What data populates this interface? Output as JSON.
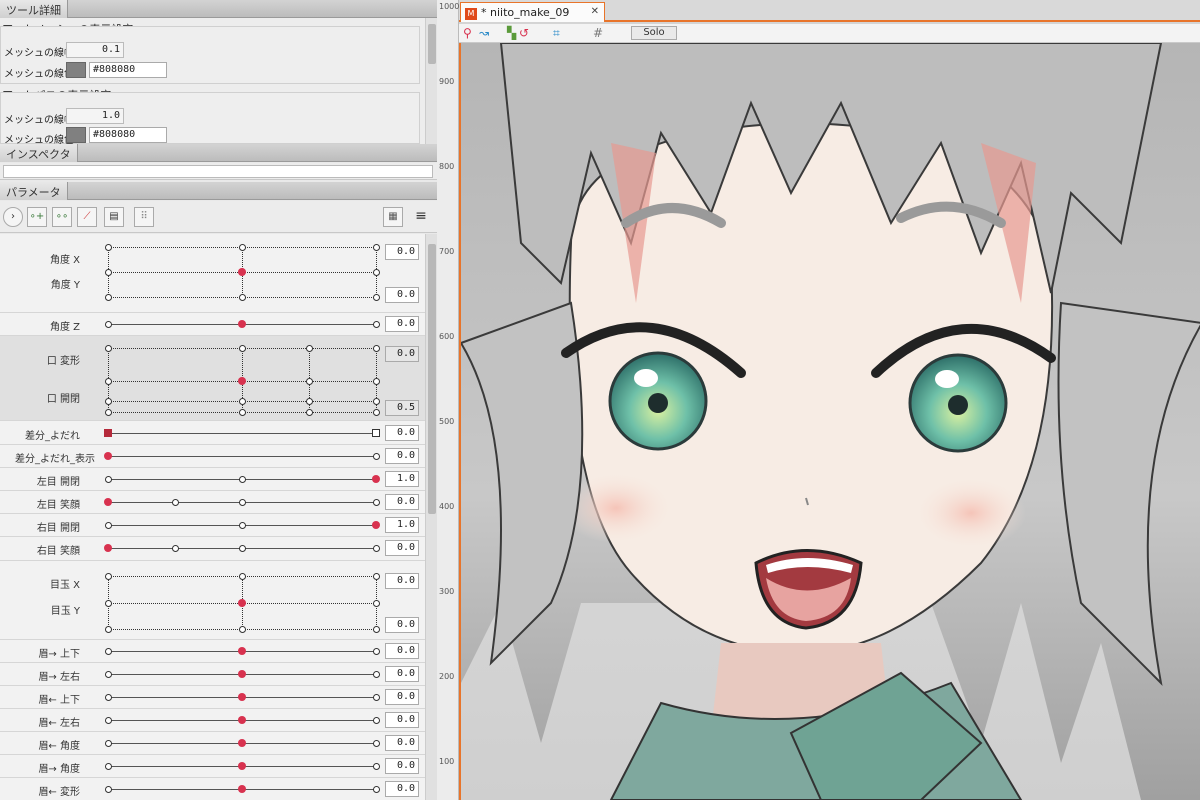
{
  "tool_panel": {
    "title": "ツール詳細",
    "section1": "アートメッシュの表示設定",
    "section2": "アートパスの表示設定",
    "mesh_width_label": "メッシュの線幅",
    "mesh_color_label": "メッシュの線色",
    "mesh_width_value": "0.1",
    "mesh_color_value": "#808080",
    "path_width_value": "1.0",
    "path_color_value": "#808080"
  },
  "inspector": {
    "title": "インスペクタ"
  },
  "params_panel": {
    "title": "パラメータ"
  },
  "params": [
    {
      "label": "角度 X",
      "value": "0.0"
    },
    {
      "label": "角度 Y",
      "value": "0.0"
    },
    {
      "label": "角度 Z",
      "value": "0.0"
    },
    {
      "label": "口 変形",
      "value": "0.0"
    },
    {
      "label": "口 開閉",
      "value": "0.5"
    },
    {
      "label": "差分_よだれ",
      "value": "0.0"
    },
    {
      "label": "差分_よだれ_表示",
      "value": "0.0"
    },
    {
      "label": "左目 開閉",
      "value": "1.0"
    },
    {
      "label": "左目 笑顔",
      "value": "0.0"
    },
    {
      "label": "右目 開閉",
      "value": "1.0"
    },
    {
      "label": "右目 笑顔",
      "value": "0.0"
    },
    {
      "label": "目玉 X",
      "value": "0.0"
    },
    {
      "label": "目玉 Y",
      "value": "0.0"
    },
    {
      "label": "眉→ 上下",
      "value": "0.0"
    },
    {
      "label": "眉→ 左右",
      "value": "0.0"
    },
    {
      "label": "眉← 上下",
      "value": "0.0"
    },
    {
      "label": "眉← 左右",
      "value": "0.0"
    },
    {
      "label": "眉← 角度",
      "value": "0.0"
    },
    {
      "label": "眉→ 角度",
      "value": "0.0"
    },
    {
      "label": "眉← 変形",
      "value": "0.0"
    }
  ],
  "ruler": [
    "1000",
    "900",
    "800",
    "700",
    "600",
    "500",
    "400",
    "300",
    "200",
    "100"
  ],
  "document": {
    "tab_title": "* niito_make_09",
    "solo_label": "Solo"
  },
  "colors": {
    "accent": "#e8742a",
    "key_active": "#d8324f",
    "mesh_color": "#808080"
  }
}
